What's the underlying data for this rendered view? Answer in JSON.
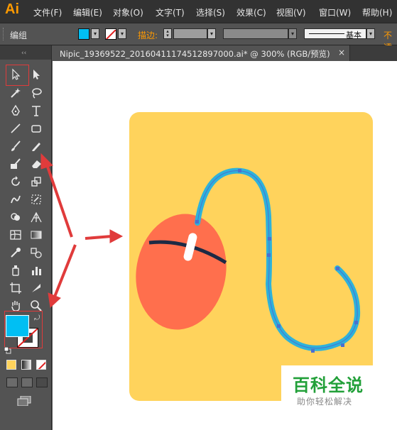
{
  "app": {
    "logo": "Ai"
  },
  "menu": {
    "items": [
      {
        "label": "文件(F)"
      },
      {
        "label": "编辑(E)"
      },
      {
        "label": "对象(O)"
      },
      {
        "label": "文字(T)"
      },
      {
        "label": "选择(S)"
      },
      {
        "label": "效果(C)"
      },
      {
        "label": "视图(V)"
      },
      {
        "label": "窗口(W)"
      },
      {
        "label": "帮助(H)"
      }
    ]
  },
  "control_bar": {
    "selection_label": "编组",
    "fill_color": "#00BFF3",
    "stroke_label": "描边:",
    "profile_label": "基本",
    "opacity_label": "不透"
  },
  "document": {
    "tab_title": "Nipic_19369522_20160411174512897000.ai* @ 300% (RGB/预览)",
    "close_glyph": "×"
  },
  "colors": {
    "accent": "#FF9A00",
    "fill": "#00BFF3",
    "artboard_bg": "#FFD35C",
    "mouse_body": "#FF6F4D",
    "cable": "#2EB2DA",
    "annotation": "#E03B3B"
  },
  "watermark": {
    "main": "百科全说",
    "sub": "助你轻松解决"
  },
  "tools": [
    "selection-tool",
    "direct-selection-tool",
    "magic-wand-tool",
    "lasso-tool",
    "pen-tool",
    "type-tool",
    "line-tool",
    "rectangle-tool",
    "paintbrush-tool",
    "pencil-tool",
    "blob-brush-tool",
    "eraser-tool",
    "rotate-tool",
    "scale-tool",
    "warp-tool",
    "free-transform-tool",
    "shape-builder-tool",
    "perspective-grid-tool",
    "mesh-tool",
    "gradient-tool",
    "eyedropper-tool",
    "blend-tool",
    "symbol-sprayer-tool",
    "column-graph-tool",
    "artboard-tool",
    "slice-tool",
    "hand-tool",
    "zoom-tool"
  ]
}
